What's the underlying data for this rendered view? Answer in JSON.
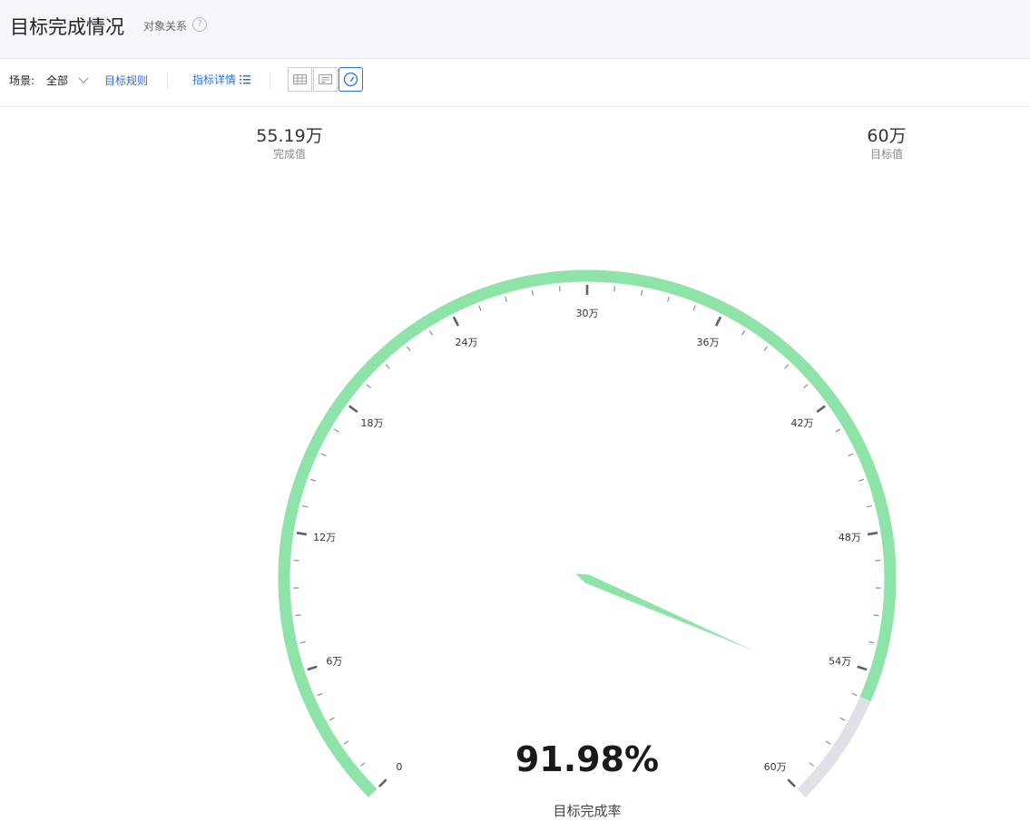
{
  "header": {
    "title": "目标完成情况",
    "sub_link": "对象关系",
    "help_icon": "?"
  },
  "toolbar": {
    "scene_label": "场景:",
    "scene_value": "全部",
    "rules_link": "目标规则",
    "detail_link": "指标详情",
    "views": [
      "table-view-icon",
      "card-view-icon",
      "gauge-view-icon"
    ],
    "active_view": "gauge-view-icon"
  },
  "stats": {
    "actual_value": "55.19万",
    "actual_label": "完成值",
    "target_value": "60万",
    "target_label": "目标值"
  },
  "gauge": {
    "min": 0,
    "max": 600000,
    "value": 551900,
    "percent": "91.98%",
    "percent_label": "目标完成率",
    "major_step": 60000,
    "minor_per_major": 5,
    "tick_labels": [
      "0",
      "6万",
      "12万",
      "18万",
      "24万",
      "30万",
      "36万",
      "42万",
      "48万",
      "54万",
      "60万"
    ],
    "colors": {
      "progress": "#8ee3a9",
      "track": "#dfe1e7",
      "needle": "#8ee3a9",
      "tick_major": "#5c6270",
      "tick_minor": "#8a8f99",
      "accent": "#2f6fd9"
    }
  }
}
